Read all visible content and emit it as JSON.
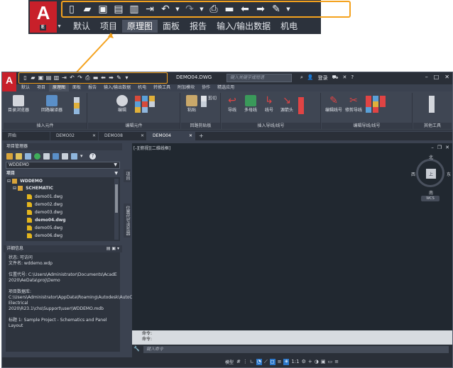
{
  "zoom": {
    "logo_letter": "A",
    "logo_sub": "E",
    "qat_icons": [
      "new-icon",
      "open-icon",
      "save-icon",
      "save-as-icon",
      "publish-icon",
      "export-icon",
      "undo-icon",
      "redo-icon",
      "print-icon",
      "folder-icon",
      "back-icon",
      "forward-icon",
      "sign-icon",
      "customize-icon"
    ],
    "tabs": [
      {
        "label": "默认"
      },
      {
        "label": "项目"
      },
      {
        "label": "原理图",
        "active": true
      },
      {
        "label": "面板"
      },
      {
        "label": "报告"
      },
      {
        "label": "输入/输出数据"
      },
      {
        "label": "机电"
      }
    ]
  },
  "window": {
    "logo_letter": "A",
    "document_title": "DEMO04.DWG",
    "search_placeholder": "键入关键字或短语",
    "login_label": "登录",
    "ribbon_tabs": [
      {
        "label": "默认"
      },
      {
        "label": "项目"
      },
      {
        "label": "原理图",
        "active": true
      },
      {
        "label": "面板"
      },
      {
        "label": "报告"
      },
      {
        "label": "输入/输出数据"
      },
      {
        "label": "机电"
      },
      {
        "label": "转换工具"
      },
      {
        "label": "附加模块"
      },
      {
        "label": "协作"
      },
      {
        "label": "精选应用"
      }
    ]
  },
  "ribbon": {
    "panels": [
      {
        "title": "插入元件",
        "buttons": [
          "目录浏览器",
          "回路编译器"
        ]
      },
      {
        "title": "编辑元件",
        "buttons": [
          "编辑"
        ]
      },
      {
        "title": "回路剪贴板",
        "buttons": [
          "粘贴",
          "剪切"
        ]
      },
      {
        "title": "插入导线/线号",
        "buttons": [
          "导线",
          "多母线",
          "线号",
          "源箭头"
        ]
      },
      {
        "title": "编辑导线/线号",
        "buttons": [
          "编辑线号",
          "修剪导线"
        ]
      },
      {
        "title": "其他工具",
        "buttons": []
      }
    ]
  },
  "doc_tabs": [
    {
      "label": "开始"
    },
    {
      "label": "DEMO02"
    },
    {
      "label": "DEMO08"
    },
    {
      "label": "DEMO04",
      "active": true
    }
  ],
  "project_manager": {
    "title": "项目管理器",
    "project_select": "WDDEMO",
    "section_label": "项目",
    "tree": {
      "project": "WDDEMO",
      "folder": "SCHEMATIC",
      "files": [
        {
          "name": "demo01.dwg",
          "bold": false
        },
        {
          "name": "demo02.dwg",
          "bold": false
        },
        {
          "name": "demo03.dwg",
          "bold": false
        },
        {
          "name": "demo04.dwg",
          "bold": true
        },
        {
          "name": "demo05.dwg",
          "bold": false
        },
        {
          "name": "demo06.dwg",
          "bold": false
        }
      ]
    },
    "details_title": "详细信息",
    "details": [
      "状态: 可访问",
      "文件名: wddemo.wdp",
      "位置代号: C:\\Users\\Administrator\\Documents\\AcadE 2020\\AeData\\proj\\Demo",
      "项目数据库: C:\\Users\\Administrator\\AppData\\Roaming\\Autodesk\\AutoCAD Electrical 2020\\R23.1\\chs\\Support\\user\\WDDEMO.mdb",
      "标题 1: Sample Project - Schematics and Panel Layout"
    ],
    "side_tabs": [
      "项目",
      "位置代号浏览器"
    ]
  },
  "canvas": {
    "viewport_label": "[-][俯视][二维线框]",
    "compass": {
      "north": "北",
      "south": "南",
      "east": "东",
      "west": "西",
      "top": "上"
    },
    "wcs_label": "WCS"
  },
  "command": {
    "history": [
      "命令:",
      "命令:"
    ],
    "placeholder": "键入命令"
  },
  "status": {
    "model_label": "模型",
    "scale_label": "1:1"
  }
}
